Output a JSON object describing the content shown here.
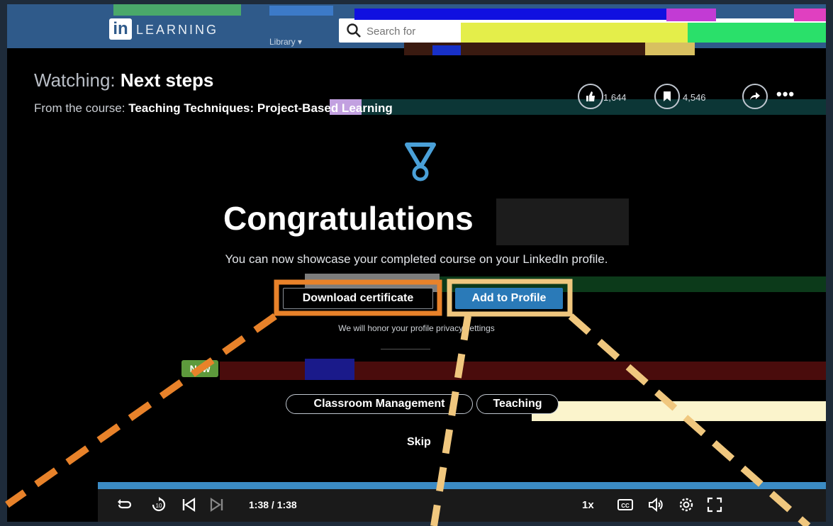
{
  "header": {
    "logo_mark": "in",
    "logo_text": "LEARNING",
    "library_label": "Library ▾",
    "search_placeholder": "Search for"
  },
  "watching": {
    "prefix": "Watching: ",
    "title": "Next steps",
    "course_prefix": "From the course: ",
    "course_name": "Teaching Techniques: Project-Based Learning"
  },
  "actions": {
    "likes": "1,644",
    "saves": "4,546"
  },
  "completion": {
    "heading": "Congratulations",
    "subtitle": "You can now showcase your completed course on your LinkedIn profile.",
    "download_label": "Download certificate",
    "add_profile_label": "Add to Profile",
    "privacy_note": "We will honor your profile privacy settings",
    "new_badge": "New",
    "skills": [
      "Classroom Management",
      "Teaching"
    ],
    "skip_label": "Skip"
  },
  "player": {
    "time": "1:38 / 1:38",
    "speed": "1x",
    "cc_label": "CC",
    "progress": 1.0
  },
  "colors": {
    "brand_blue": "#2f5a8a",
    "profile_button": "#2a7ab8",
    "new_badge": "#5d9a3c",
    "highlight_download": "#e8822a",
    "highlight_profile": "#f0c77e"
  }
}
